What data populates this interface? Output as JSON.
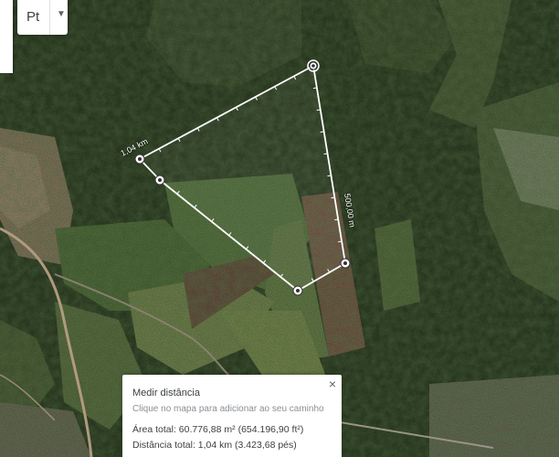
{
  "language": {
    "selected": "Pt"
  },
  "measure": {
    "title": "Medir distância",
    "hint": "Clique no mapa para adicionar ao seu caminho",
    "area": "Área total: 60.776,88 m² (654.196,90 ft²)",
    "distance": "Distância total: 1,04 km (3.423,68 pés)",
    "close_icon": "×"
  },
  "overlay": {
    "label_total": "1,04 km",
    "label_segment": "500,00 m",
    "line_color": "#ffffff"
  }
}
